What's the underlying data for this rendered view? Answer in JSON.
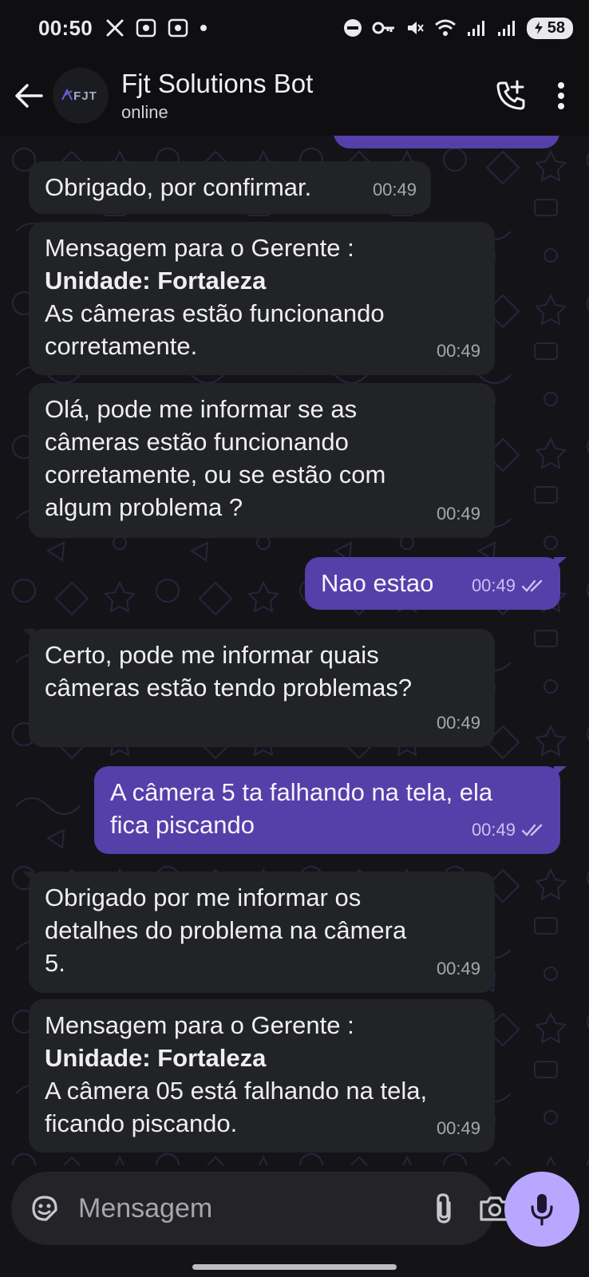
{
  "status_bar": {
    "time": "00:50",
    "battery": "58"
  },
  "header": {
    "avatar_text": "FJT",
    "contact_name": "Fjt Solutions Bot",
    "contact_status": "online"
  },
  "messages": [
    {
      "dir": "in",
      "lines": [
        "Obrigado, por confirmar."
      ],
      "time": "00:49"
    },
    {
      "dir": "in",
      "lines": [
        "Mensagem para o Gerente :"
      ],
      "bold": "Unidade: Fortaleza",
      "after_bold": [
        "As câmeras estão funcionando",
        "corretamente."
      ],
      "time": "00:49"
    },
    {
      "dir": "in",
      "lines": [
        "Olá, pode me informar se as",
        "câmeras estão funcionando",
        "corretamente, ou se estão com",
        "algum problema ?"
      ],
      "time": "00:49"
    },
    {
      "dir": "out",
      "lines": [
        "Nao estao"
      ],
      "time": "00:49"
    },
    {
      "dir": "in",
      "lines": [
        "Certo, pode me informar quais",
        "câmeras estão tendo problemas?"
      ],
      "time": "00:49"
    },
    {
      "dir": "out",
      "lines": [
        "A câmera 5 ta falhando na tela, ela",
        "fica piscando"
      ],
      "time": "00:49"
    },
    {
      "dir": "in",
      "lines": [
        "Obrigado por me informar os",
        "detalhes do problema na câmera",
        "5."
      ],
      "time": "00:49"
    },
    {
      "dir": "in",
      "lines": [
        "Mensagem para o Gerente :"
      ],
      "bold": "Unidade: Fortaleza",
      "after_bold": [
        "A câmera 05 está falhando na tela,",
        "ficando piscando."
      ],
      "time": "00:49"
    }
  ],
  "composer": {
    "placeholder": "Mensagem"
  },
  "colors": {
    "outgoing_bubble": "#5440a8",
    "incoming_bubble": "#222327",
    "mic_button": "#b9a7ff"
  }
}
